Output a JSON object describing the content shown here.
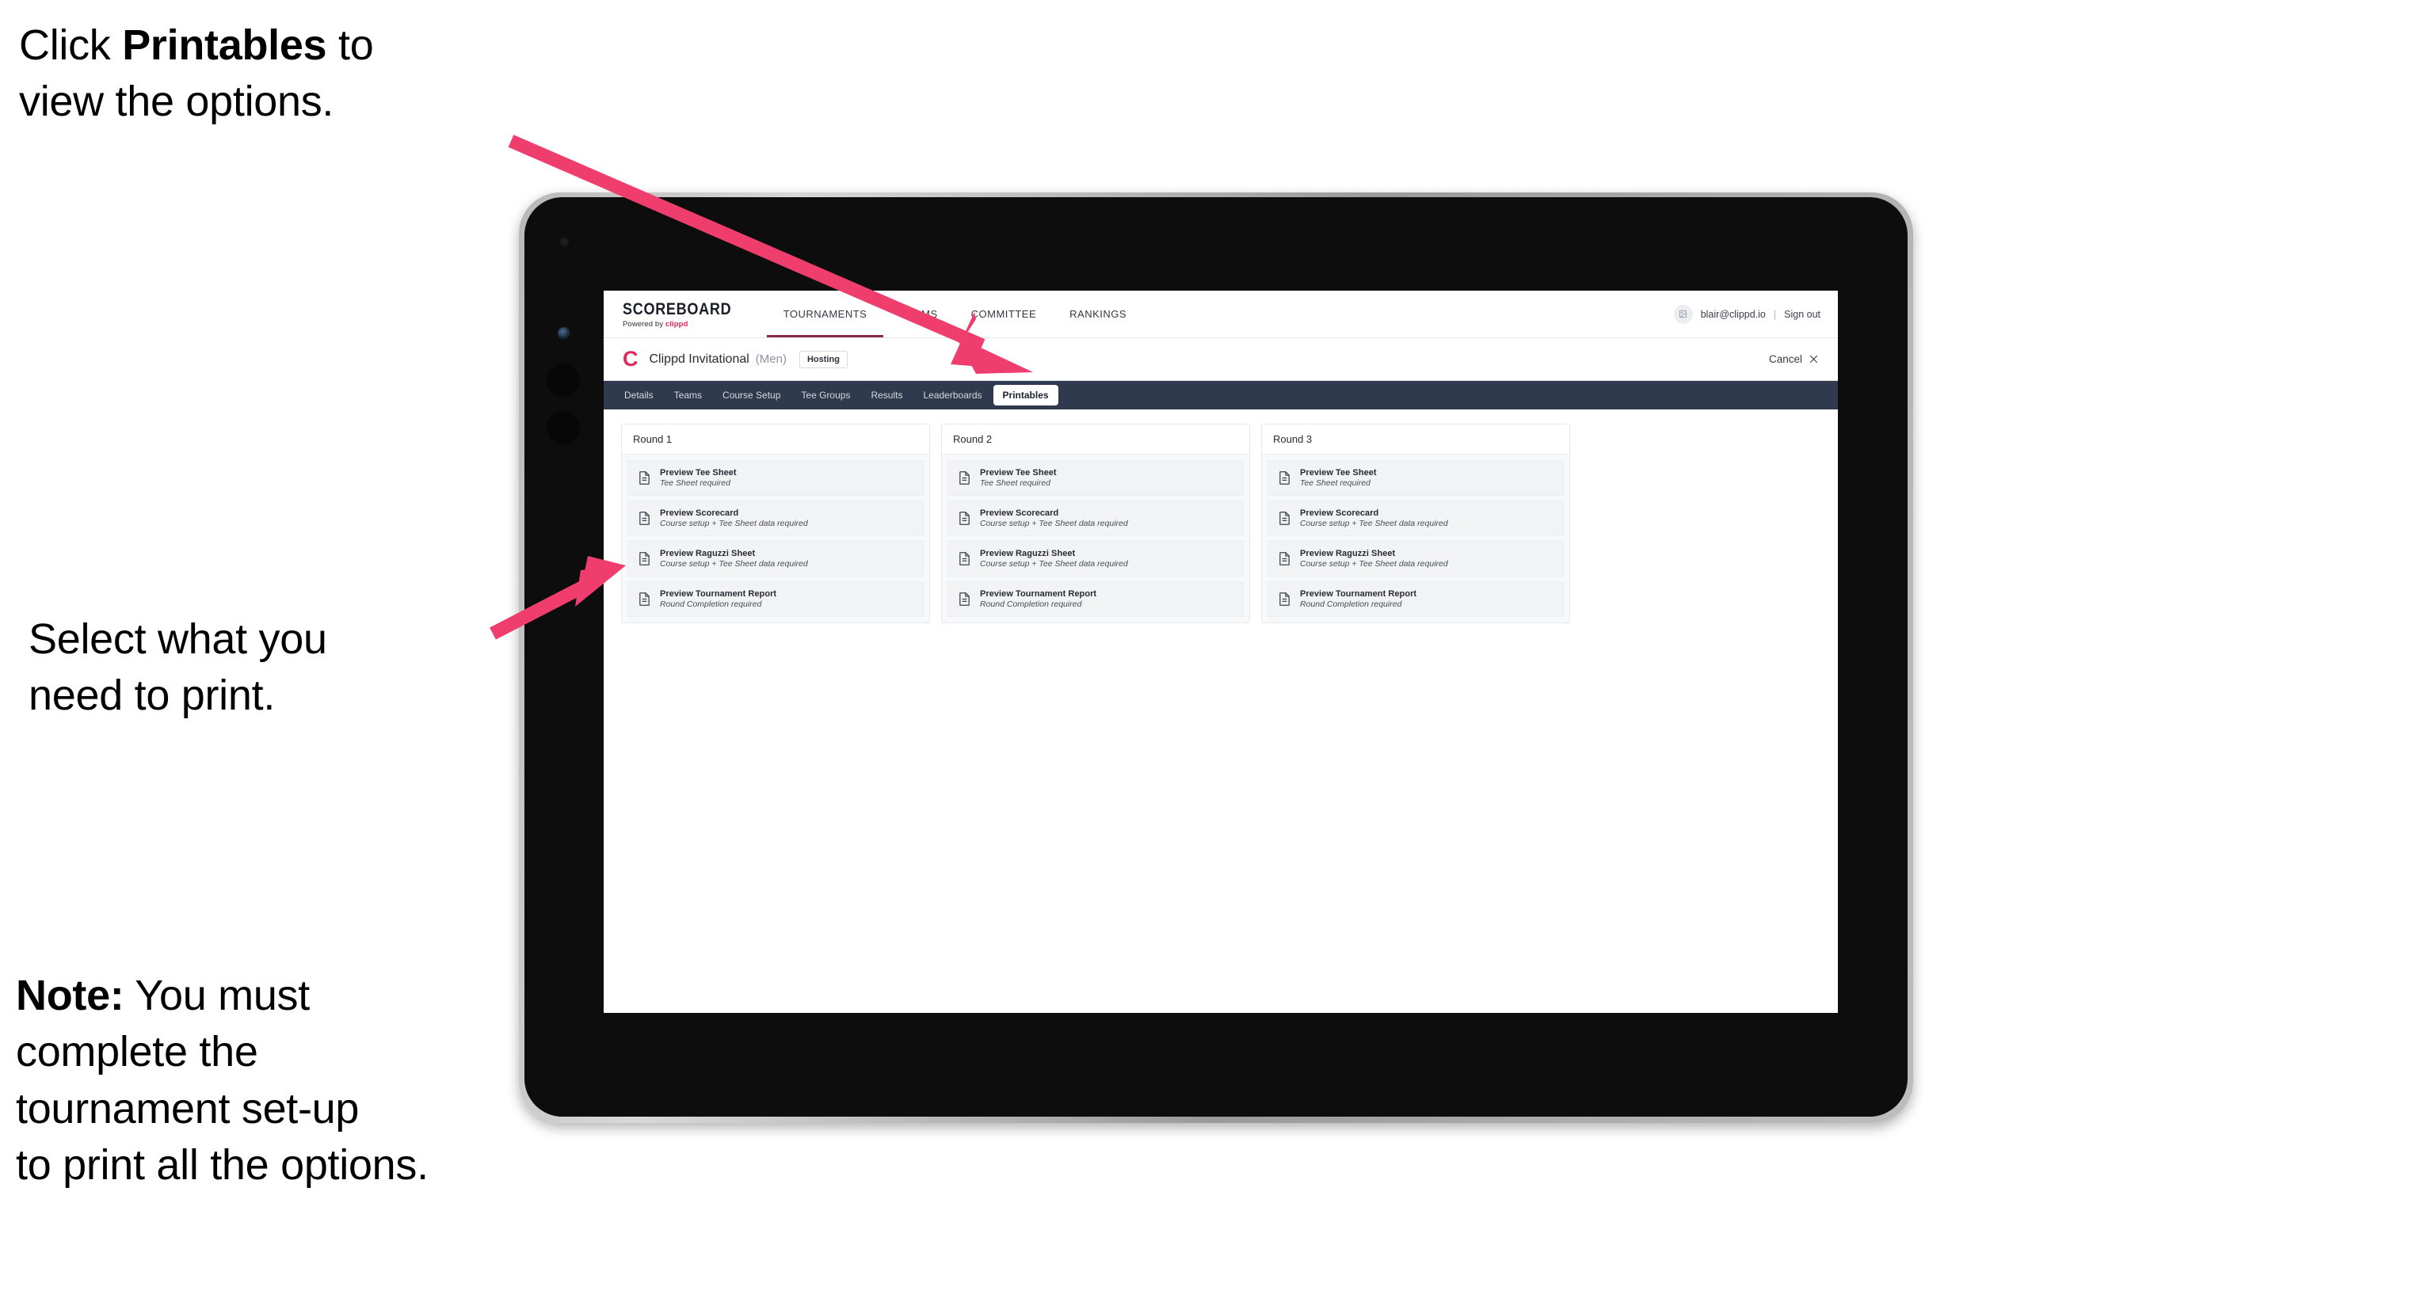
{
  "annotations": {
    "step1": {
      "prefix": "Click ",
      "bold": "Printables",
      "suffix": " to\nview the options."
    },
    "step2": {
      "text": "Select what you\n need to print."
    },
    "note": {
      "bold": "Note:",
      "text": " You must\ncomplete the\ntournament set-up\nto print all the options."
    }
  },
  "app": {
    "brand": {
      "name": "SCOREBOARD",
      "powered_prefix": "Powered by ",
      "powered_brand": "clippd"
    },
    "topnav": [
      {
        "label": "TOURNAMENTS",
        "active": true
      },
      {
        "label": "TEAMS",
        "active": false
      },
      {
        "label": "COMMITTEE",
        "active": false
      },
      {
        "label": "RANKINGS",
        "active": false
      }
    ],
    "account": {
      "avatar_glyph": "⛶",
      "email": "blair@clippd.io",
      "separator": "|",
      "sign_out": "Sign out"
    },
    "subbar": {
      "logo_letter": "C",
      "tournament_name": "Clippd Invitational",
      "gender": "(Men)",
      "role_badge": "Hosting",
      "cancel_label": "Cancel",
      "cancel_icon": "close-icon"
    },
    "tabs": [
      {
        "label": "Details",
        "active": false
      },
      {
        "label": "Teams",
        "active": false
      },
      {
        "label": "Course Setup",
        "active": false
      },
      {
        "label": "Tee Groups",
        "active": false
      },
      {
        "label": "Results",
        "active": false
      },
      {
        "label": "Leaderboards",
        "active": false
      },
      {
        "label": "Printables",
        "active": true
      }
    ],
    "rounds": [
      {
        "title": "Round 1",
        "items": [
          {
            "title": "Preview Tee Sheet",
            "subtitle": "Tee Sheet required"
          },
          {
            "title": "Preview Scorecard",
            "subtitle": "Course setup + Tee Sheet data required"
          },
          {
            "title": "Preview Raguzzi Sheet",
            "subtitle": "Course setup + Tee Sheet data required"
          },
          {
            "title": "Preview Tournament Report",
            "subtitle": "Round Completion required"
          }
        ]
      },
      {
        "title": "Round 2",
        "items": [
          {
            "title": "Preview Tee Sheet",
            "subtitle": "Tee Sheet required"
          },
          {
            "title": "Preview Scorecard",
            "subtitle": "Course setup + Tee Sheet data required"
          },
          {
            "title": "Preview Raguzzi Sheet",
            "subtitle": "Course setup + Tee Sheet data required"
          },
          {
            "title": "Preview Tournament Report",
            "subtitle": "Round Completion required"
          }
        ]
      },
      {
        "title": "Round 3",
        "items": [
          {
            "title": "Preview Tee Sheet",
            "subtitle": "Tee Sheet required"
          },
          {
            "title": "Preview Scorecard",
            "subtitle": "Course setup + Tee Sheet data required"
          },
          {
            "title": "Preview Raguzzi Sheet",
            "subtitle": "Course setup + Tee Sheet data required"
          },
          {
            "title": "Preview Tournament Report",
            "subtitle": "Round Completion required"
          }
        ]
      }
    ]
  },
  "colors": {
    "accent_pink": "#ef3d6d",
    "brand_pink": "#e0285a",
    "navbar_dark": "#2f3a4e",
    "active_underline": "#8c2a4a",
    "card_row_bg": "#f2f3f5"
  }
}
